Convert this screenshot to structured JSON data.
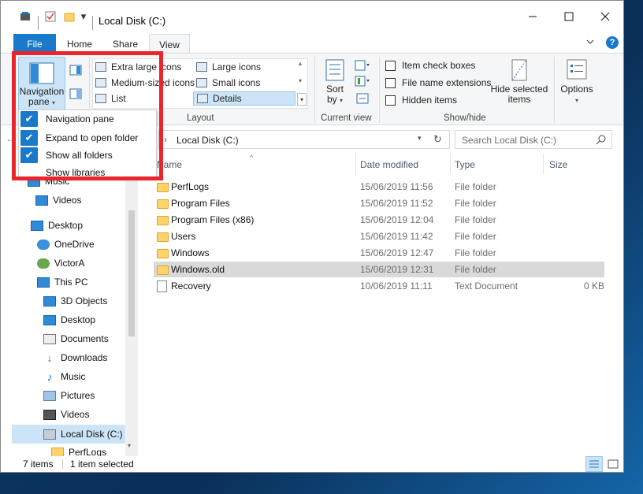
{
  "window": {
    "title": "Local Disk (C:)",
    "quick_access_dropdown": "▾"
  },
  "tabs": [
    {
      "label": "File"
    },
    {
      "label": "Home"
    },
    {
      "label": "Share"
    },
    {
      "label": "View"
    }
  ],
  "ribbon": {
    "panes": {
      "navigation_pane_label": "Navigation",
      "navigation_pane_label2": "pane"
    },
    "layout": {
      "items": [
        "Extra large icons",
        "Large icons",
        "Medium-sized icons",
        "Small icons",
        "List",
        "Details"
      ],
      "group": "Layout"
    },
    "current_view": {
      "sort_label": "Sort",
      "sort_label2": "by",
      "group": "Current view"
    },
    "show_hide": {
      "item_check_boxes": "Item check boxes",
      "file_name_extensions": "File name extensions",
      "hidden_items": "Hidden items",
      "hide_selected_1": "Hide selected",
      "hide_selected_2": "items",
      "group": "Show/hide"
    },
    "options_label": "Options"
  },
  "address": {
    "path": "Local Disk (C:)",
    "search_placeholder": "Search Local Disk (C:)"
  },
  "dropdown": {
    "items": [
      {
        "label": "Navigation pane",
        "checked": true
      },
      {
        "label": "Expand to open folder",
        "checked": true
      },
      {
        "label": "Show all folders",
        "checked": true
      },
      {
        "label": "Show libraries",
        "checked": false
      }
    ]
  },
  "navpane": {
    "items": [
      {
        "label": "Music"
      },
      {
        "label": "Videos"
      },
      {
        "label": "Desktop"
      },
      {
        "label": "OneDrive"
      },
      {
        "label": "VictorA"
      },
      {
        "label": "This PC"
      },
      {
        "label": "3D Objects"
      },
      {
        "label": "Desktop"
      },
      {
        "label": "Documents"
      },
      {
        "label": "Downloads"
      },
      {
        "label": "Music"
      },
      {
        "label": "Pictures"
      },
      {
        "label": "Videos"
      },
      {
        "label": "Local Disk (C:)"
      },
      {
        "label": "PerfLogs"
      }
    ]
  },
  "filelist": {
    "columns": {
      "name": "Name",
      "date": "Date modified",
      "type": "Type",
      "size": "Size"
    },
    "rows": [
      {
        "name": "PerfLogs",
        "date": "15/06/2019 11:56",
        "type": "File folder",
        "size": ""
      },
      {
        "name": "Program Files",
        "date": "15/06/2019 11:52",
        "type": "File folder",
        "size": ""
      },
      {
        "name": "Program Files (x86)",
        "date": "15/06/2019 12:04",
        "type": "File folder",
        "size": ""
      },
      {
        "name": "Users",
        "date": "15/06/2019 11:42",
        "type": "File folder",
        "size": ""
      },
      {
        "name": "Windows",
        "date": "15/06/2019 12:47",
        "type": "File folder",
        "size": ""
      },
      {
        "name": "Windows.old",
        "date": "15/06/2019 12:31",
        "type": "File folder",
        "size": ""
      },
      {
        "name": "Recovery",
        "date": "10/06/2019 11:11",
        "type": "Text Document",
        "size": "0 KB"
      }
    ]
  },
  "statusbar": {
    "items_count": "7 items",
    "selected": "1 item selected"
  },
  "colors": {
    "accent": "#1979ca",
    "selection": "#cce4f7",
    "highlight_row": "#d9d9d9",
    "annotation_red": "#e8262c"
  }
}
